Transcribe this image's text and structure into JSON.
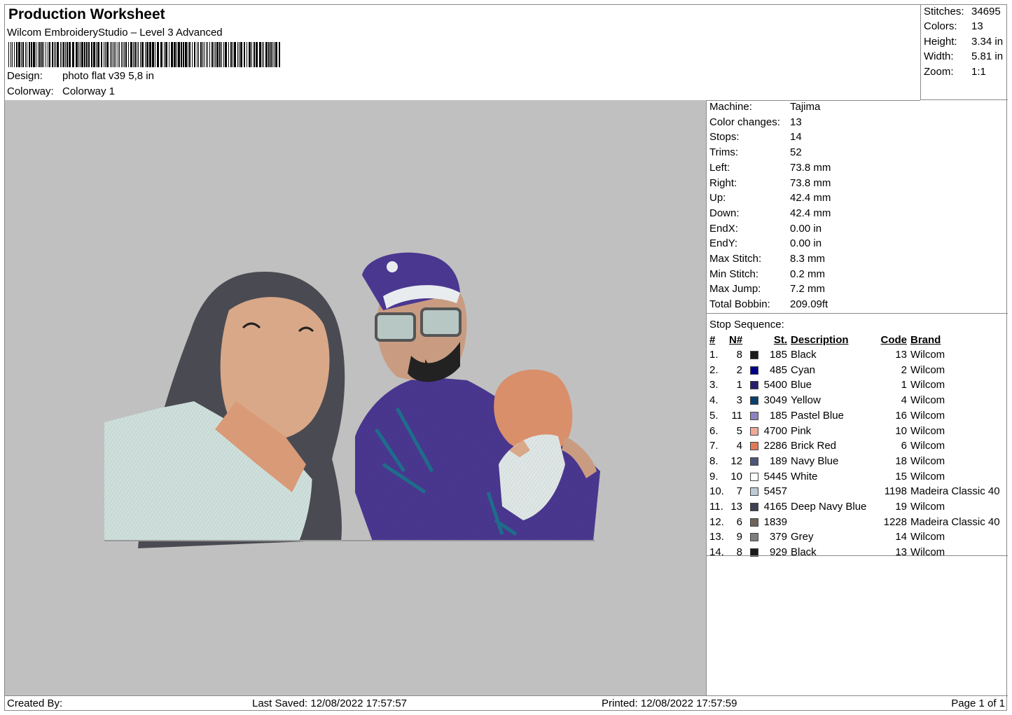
{
  "header": {
    "title": "Production Worksheet",
    "subtitle": "Wilcom EmbroideryStudio – Level 3 Advanced",
    "design_label": "Design:",
    "design_value": "photo flat v39 5,8 in",
    "colorway_label": "Colorway:",
    "colorway_value": "Colorway 1"
  },
  "stats": [
    {
      "label": "Stitches:",
      "value": "34695"
    },
    {
      "label": "Colors:",
      "value": "13"
    },
    {
      "label": "Height:",
      "value": "3.34 in"
    },
    {
      "label": "Width:",
      "value": "5.81 in"
    },
    {
      "label": "Zoom:",
      "value": "1:1"
    }
  ],
  "details": [
    {
      "label": "Machine:",
      "value": "Tajima"
    },
    {
      "label": "Color changes:",
      "value": "13"
    },
    {
      "label": "Stops:",
      "value": "14"
    },
    {
      "label": "Trims:",
      "value": "52"
    },
    {
      "label": "Left:",
      "value": "73.8 mm"
    },
    {
      "label": "Right:",
      "value": "73.8 mm"
    },
    {
      "label": "Up:",
      "value": "42.4 mm"
    },
    {
      "label": "Down:",
      "value": "42.4 mm"
    },
    {
      "label": "EndX:",
      "value": "0.00 in"
    },
    {
      "label": "EndY:",
      "value": "0.00 in"
    },
    {
      "label": "Max Stitch:",
      "value": "8.3 mm"
    },
    {
      "label": "Min Stitch:",
      "value": "0.2 mm"
    },
    {
      "label": "Max Jump:",
      "value": "7.2 mm"
    },
    {
      "label": "Total Bobbin:",
      "value": "209.09ft"
    }
  ],
  "stop_sequence": {
    "title": "Stop Sequence:",
    "columns": {
      "idx": "#",
      "n": "N#",
      "st": "St.",
      "desc": "Description",
      "code": "Code",
      "brand": "Brand"
    },
    "rows": [
      {
        "idx": "1.",
        "n": "8",
        "color": "#1a1a1a",
        "st": "185",
        "desc": "Black",
        "code": "13",
        "brand": "Wilcom"
      },
      {
        "idx": "2.",
        "n": "2",
        "color": "#00008b",
        "st": "485",
        "desc": "Cyan",
        "code": "2",
        "brand": "Wilcom"
      },
      {
        "idx": "3.",
        "n": "1",
        "color": "#2a1a6e",
        "st": "5400",
        "desc": "Blue",
        "code": "1",
        "brand": "Wilcom"
      },
      {
        "idx": "4.",
        "n": "3",
        "color": "#0b3f6e",
        "st": "3049",
        "desc": "Yellow",
        "code": "4",
        "brand": "Wilcom"
      },
      {
        "idx": "5.",
        "n": "11",
        "color": "#8a84c0",
        "st": "185",
        "desc": "Pastel Blue",
        "code": "16",
        "brand": "Wilcom"
      },
      {
        "idx": "6.",
        "n": "5",
        "color": "#f2a896",
        "st": "4700",
        "desc": "Pink",
        "code": "10",
        "brand": "Wilcom"
      },
      {
        "idx": "7.",
        "n": "4",
        "color": "#e07a56",
        "st": "2286",
        "desc": "Brick Red",
        "code": "6",
        "brand": "Wilcom"
      },
      {
        "idx": "8.",
        "n": "12",
        "color": "#4d5678",
        "st": "189",
        "desc": "Navy Blue",
        "code": "18",
        "brand": "Wilcom"
      },
      {
        "idx": "9.",
        "n": "10",
        "color": "#ffffff",
        "st": "5445",
        "desc": "White",
        "code": "15",
        "brand": "Wilcom"
      },
      {
        "idx": "10.",
        "n": "7",
        "color": "#bccbd6",
        "st": "5457",
        "desc": "",
        "code": "1198",
        "brand": "Madeira Classic 40"
      },
      {
        "idx": "11.",
        "n": "13",
        "color": "#3d4150",
        "st": "4165",
        "desc": "Deep Navy Blue",
        "code": "19",
        "brand": "Wilcom"
      },
      {
        "idx": "12.",
        "n": "6",
        "color": "#6e645a",
        "st": "1839",
        "desc": "",
        "code": "1228",
        "brand": "Madeira Classic 40"
      },
      {
        "idx": "13.",
        "n": "9",
        "color": "#7e7e7e",
        "st": "379",
        "desc": "Grey",
        "code": "14",
        "brand": "Wilcom"
      },
      {
        "idx": "14.",
        "n": "8",
        "color": "#1a1a1a",
        "st": "929",
        "desc": "Black",
        "code": "13",
        "brand": "Wilcom"
      }
    ]
  },
  "footer": {
    "created_by": "Created By:",
    "last_saved": "Last Saved: 12/08/2022 17:57:57",
    "printed": "Printed: 12/08/2022 17:57:59",
    "page": "Page 1 of 1"
  },
  "colors": {
    "preview_bg": "#c0c0c0",
    "border": "#8a8a8a"
  }
}
